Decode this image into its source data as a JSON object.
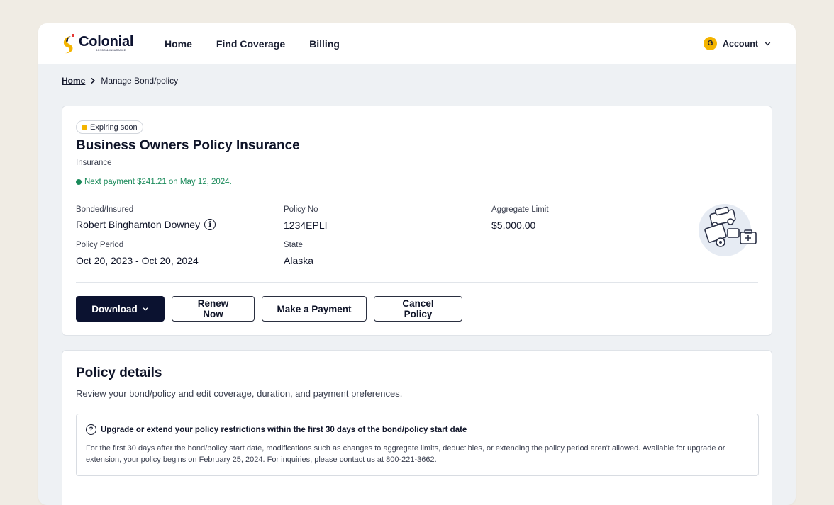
{
  "brand": {
    "name": "Colonial",
    "tagline": "BONDS & INSURANCE",
    "colors": {
      "navy": "#0b1230",
      "yellow": "#f4b400",
      "green": "#1a8a5a"
    }
  },
  "nav": {
    "links": [
      "Home",
      "Find Coverage",
      "Billing"
    ],
    "account_initial": "G",
    "account_label": "Account"
  },
  "breadcrumb": {
    "home": "Home",
    "current": "Manage Bond/policy"
  },
  "policy": {
    "status": "Expiring soon",
    "title": "Business Owners Policy Insurance",
    "type": "Insurance",
    "next_payment": "Next payment $241.21 on May 12, 2024.",
    "fields": {
      "bonded_label": "Bonded/Insured",
      "bonded_value": "Robert Binghamton Downey",
      "policy_no_label": "Policy No",
      "policy_no_value": "1234EPLI",
      "aggregate_label": "Aggregate Limit",
      "aggregate_value": "$5,000.00",
      "period_label": "Policy Period",
      "period_value": "Oct 20, 2023 - Oct 20, 2024",
      "state_label": "State",
      "state_value": "Alaska"
    },
    "actions": {
      "download": "Download",
      "renew": "Renew Now",
      "payment": "Make a Payment",
      "cancel": "Cancel Policy"
    }
  },
  "details": {
    "title": "Policy details",
    "subtitle": "Review your bond/policy and edit coverage, duration, and payment preferences.",
    "notice_title": "Upgrade or extend your policy restrictions within the first 30 days of the bond/policy start date",
    "notice_body": "For the first 30 days after the bond/policy start date, modifications such as changes to aggregate limits, deductibles, or extending the policy period aren't allowed. Available for upgrade or extension, your policy begins on February 25, 2024. For inquiries, please contact us at 800-221-3662."
  }
}
